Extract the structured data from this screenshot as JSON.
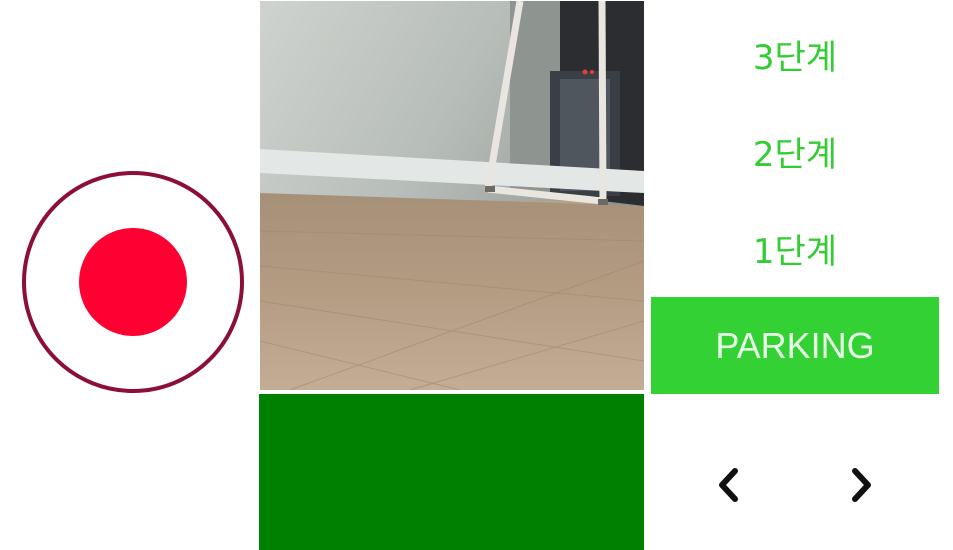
{
  "record": {
    "icon": "record-icon",
    "outer_ring_color": "#8b0f36",
    "dot_color": "#ff0033"
  },
  "camera_feed": {
    "icon": "camera-feed"
  },
  "status_panel": {
    "color": "#008000"
  },
  "levels": [
    {
      "label": "3단계"
    },
    {
      "label": "2단계"
    },
    {
      "label": "1단계"
    }
  ],
  "parking": {
    "label": "PARKING",
    "color": "#33d133"
  },
  "navigation": {
    "prev_icon": "chevron-left-icon",
    "next_icon": "chevron-right-icon"
  },
  "colors": {
    "level_text": "#33cc33"
  }
}
